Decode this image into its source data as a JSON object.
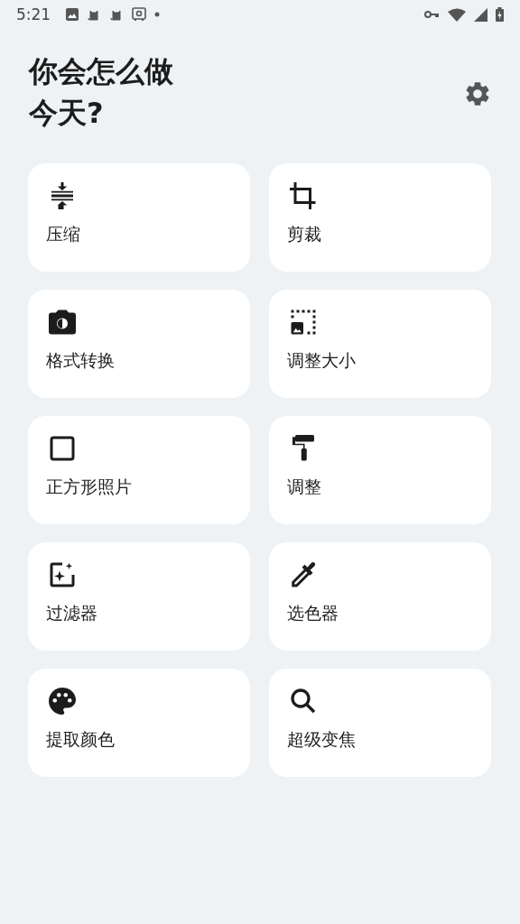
{
  "status_bar": {
    "time": "5:21"
  },
  "title": {
    "line_1": "你会怎么做",
    "line_2": "今天?"
  },
  "tools": [
    {
      "label": "压缩"
    },
    {
      "label": "剪裁"
    },
    {
      "label": "格式转换"
    },
    {
      "label": "调整大小"
    },
    {
      "label": "正方形照片"
    },
    {
      "label": "调整"
    },
    {
      "label": "过滤器"
    },
    {
      "label": "选色器"
    },
    {
      "label": "提取颜色"
    },
    {
      "label": "超级变焦"
    }
  ]
}
